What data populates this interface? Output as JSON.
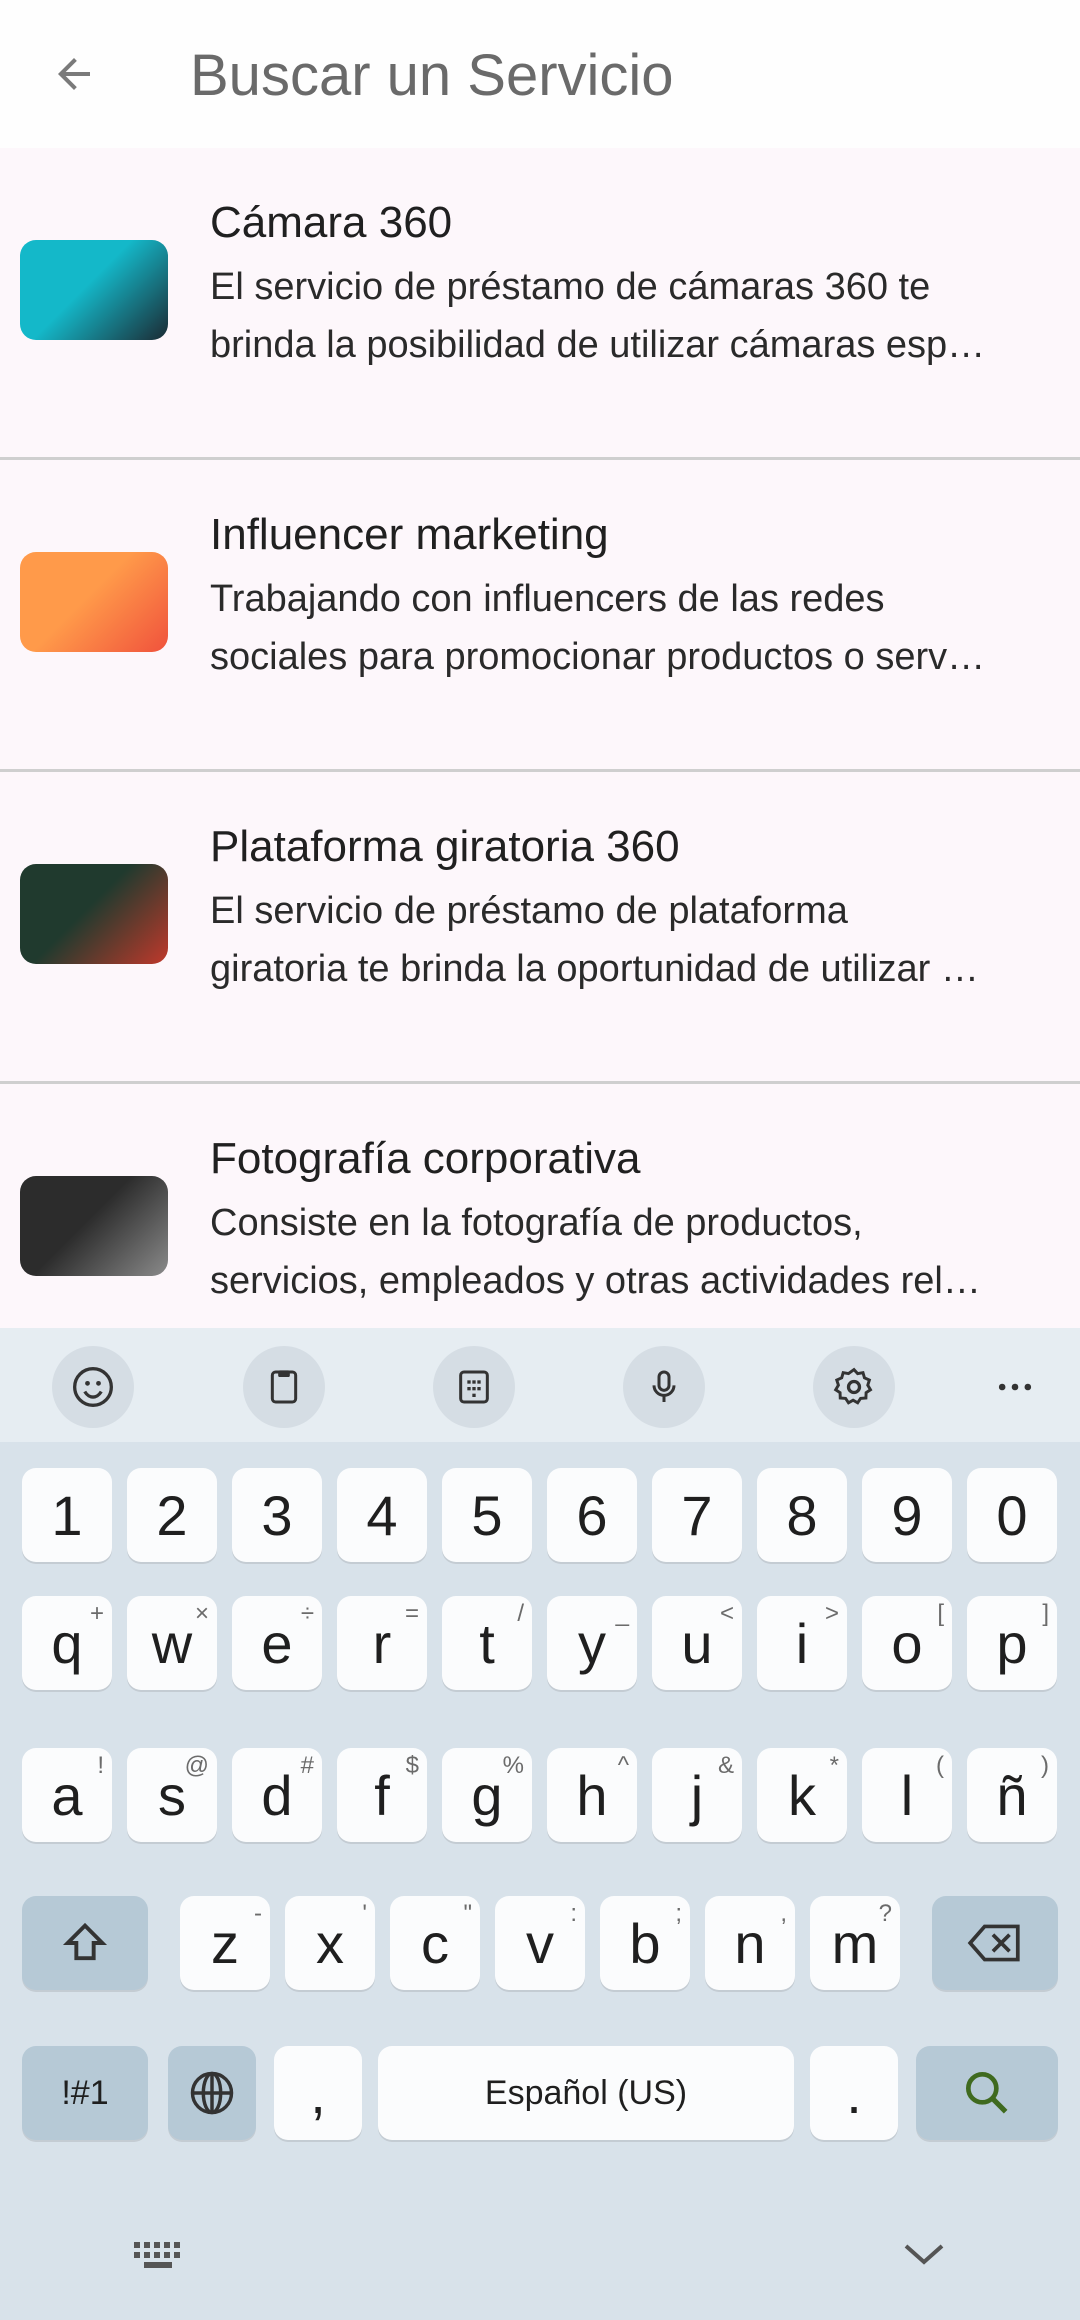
{
  "header": {
    "search_placeholder": "Buscar un Servicio"
  },
  "services": [
    {
      "title": "Cámara 360",
      "desc_lines": [
        "El servicio de préstamo de cámaras 360 te",
        "brinda la posibilidad de utilizar cámaras esp…"
      ],
      "thumb_colors": [
        "#14b8c9",
        "#1b2a33"
      ]
    },
    {
      "title": "Influencer marketing",
      "desc_lines": [
        "Trabajando con influencers de las redes",
        "sociales para promocionar productos o serv…"
      ],
      "thumb_colors": [
        "#ff9a4a",
        "#f0523c"
      ]
    },
    {
      "title": "Plataforma giratoria 360",
      "desc_lines": [
        "El servicio de préstamo de plataforma",
        "giratoria te brinda la oportunidad de utilizar …"
      ],
      "thumb_colors": [
        "#203a2e",
        "#c0392b"
      ]
    },
    {
      "title": "Fotografía corporativa",
      "desc_lines": [
        "Consiste en la fotografía de productos,",
        "servicios, empleados y otras actividades rel…"
      ],
      "thumb_colors": [
        "#2c2c2c",
        "#8a8a8a"
      ]
    }
  ],
  "keyboard": {
    "numbers": [
      "1",
      "2",
      "3",
      "4",
      "5",
      "6",
      "7",
      "8",
      "9",
      "0"
    ],
    "row1": [
      {
        "k": "q",
        "h": "+"
      },
      {
        "k": "w",
        "h": "×"
      },
      {
        "k": "e",
        "h": "÷"
      },
      {
        "k": "r",
        "h": "="
      },
      {
        "k": "t",
        "h": "/"
      },
      {
        "k": "y",
        "h": "_"
      },
      {
        "k": "u",
        "h": "<"
      },
      {
        "k": "i",
        "h": ">"
      },
      {
        "k": "o",
        "h": "["
      },
      {
        "k": "p",
        "h": "]"
      }
    ],
    "row2": [
      {
        "k": "a",
        "h": "!"
      },
      {
        "k": "s",
        "h": "@"
      },
      {
        "k": "d",
        "h": "#"
      },
      {
        "k": "f",
        "h": "$"
      },
      {
        "k": "g",
        "h": "%"
      },
      {
        "k": "h",
        "h": "^"
      },
      {
        "k": "j",
        "h": "&"
      },
      {
        "k": "k",
        "h": "*"
      },
      {
        "k": "l",
        "h": "("
      },
      {
        "k": "ñ",
        "h": ")"
      }
    ],
    "row3": [
      {
        "k": "z",
        "h": "-"
      },
      {
        "k": "x",
        "h": "'"
      },
      {
        "k": "c",
        "h": "\""
      },
      {
        "k": "v",
        "h": ":"
      },
      {
        "k": "b",
        "h": ";"
      },
      {
        "k": "n",
        "h": ","
      },
      {
        "k": "m",
        "h": "?"
      }
    ],
    "symbols_label": "!#1",
    "comma": ",",
    "space_label": "Español (US)",
    "period": ".",
    "toolbar_icons": [
      "emoji-icon",
      "clipboard-icon",
      "keypad-icon",
      "mic-icon",
      "settings-icon",
      "more-icon"
    ],
    "accent": "#b6c9d6"
  }
}
